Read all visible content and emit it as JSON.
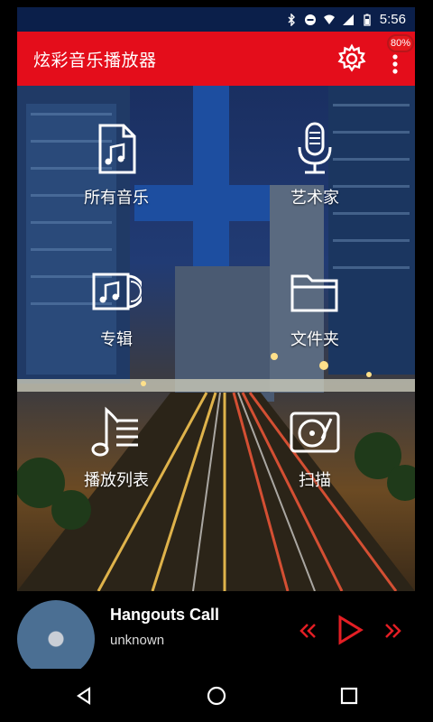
{
  "status_bar": {
    "time": "5:56",
    "icons": [
      "bluetooth-icon",
      "do-not-disturb-icon",
      "wifi-icon",
      "signal-icon",
      "battery-icon"
    ]
  },
  "app_bar": {
    "title": "炫彩音乐播放器",
    "settings_icon": "gear-icon",
    "overflow_icon": "more-vert-icon",
    "badge_text": "80%"
  },
  "menu": {
    "items": [
      {
        "label": "所有音乐",
        "icon": "music-file-icon"
      },
      {
        "label": "艺术家",
        "icon": "microphone-icon"
      },
      {
        "label": "专辑",
        "icon": "album-icon"
      },
      {
        "label": "文件夹",
        "icon": "folder-icon"
      },
      {
        "label": "播放列表",
        "icon": "playlist-icon"
      },
      {
        "label": "扫描",
        "icon": "turntable-icon"
      }
    ]
  },
  "now_playing": {
    "title": "Hangouts Call",
    "artist": "unknown"
  },
  "colors": {
    "accent": "#e40d1b",
    "control": "#e31e24"
  }
}
